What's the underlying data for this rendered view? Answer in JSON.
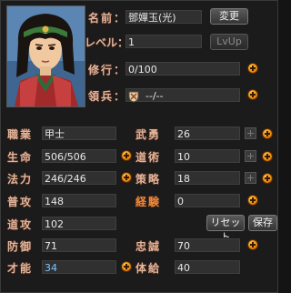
{
  "portrait": {
    "alt": "general-portrait"
  },
  "profile": {
    "name_label": "名前：",
    "name_value": "鄧嬋玉(光)",
    "change_button": "変更",
    "level_label": "レベル：",
    "level_value": "1",
    "levelup_button": "LvUp",
    "training_label": "修行：",
    "training_value": "0/100",
    "troops_label": "領兵：",
    "troops_value": "--/--"
  },
  "stats_left": [
    {
      "label": "職業",
      "value": "甲士"
    },
    {
      "label": "生命",
      "value": "506/506"
    },
    {
      "label": "法力",
      "value": "246/246"
    },
    {
      "label": "普攻",
      "value": "148"
    },
    {
      "label": "道攻",
      "value": "102"
    },
    {
      "label": "防御",
      "value": "71"
    },
    {
      "label": "才能",
      "value": "34"
    }
  ],
  "stats_right": [
    {
      "label": "武勇",
      "value": "26"
    },
    {
      "label": "道術",
      "value": "10"
    },
    {
      "label": "策略",
      "value": "18"
    },
    {
      "label": "経験",
      "value": "0"
    },
    {
      "label": "忠誠",
      "value": "70"
    },
    {
      "label": "体給",
      "value": "40"
    }
  ],
  "buttons": {
    "reset": "リセット",
    "save": "保存"
  },
  "colors": {
    "label": "#e2b49a",
    "talent_value": "#7fc4ff",
    "plus": "#f08a00"
  }
}
